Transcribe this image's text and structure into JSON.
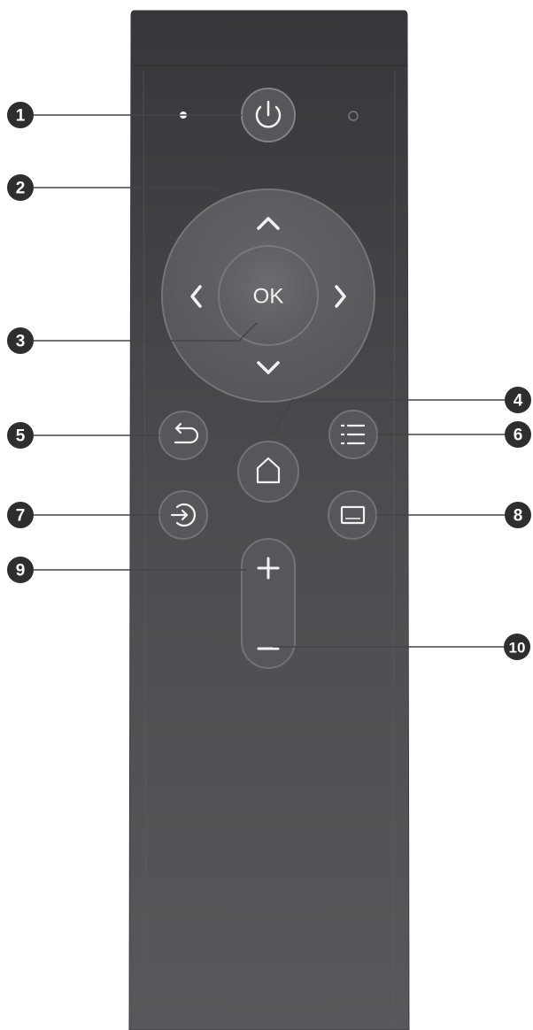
{
  "remote": {
    "colors": {
      "body_top": "#35373a",
      "body_bottom": "#55575a",
      "button_fill": "#5c5e61",
      "button_ring": "#77797c",
      "icon": "#f2f2f2",
      "callout_fill": "#2e2e2e",
      "leader_line": "#4a4a4a"
    },
    "buttons": {
      "ok_label": "OK"
    }
  },
  "callouts": [
    {
      "number": "1",
      "target": "power-button"
    },
    {
      "number": "2",
      "target": "navigation-pad"
    },
    {
      "number": "3",
      "target": "ok-button"
    },
    {
      "number": "4",
      "target": "home-button"
    },
    {
      "number": "5",
      "target": "back-button"
    },
    {
      "number": "6",
      "target": "menu-button"
    },
    {
      "number": "7",
      "target": "input-source-button"
    },
    {
      "number": "8",
      "target": "subtitle-button"
    },
    {
      "number": "9",
      "target": "volume-up-button"
    },
    {
      "number": "10",
      "target": "volume-down-button"
    }
  ]
}
